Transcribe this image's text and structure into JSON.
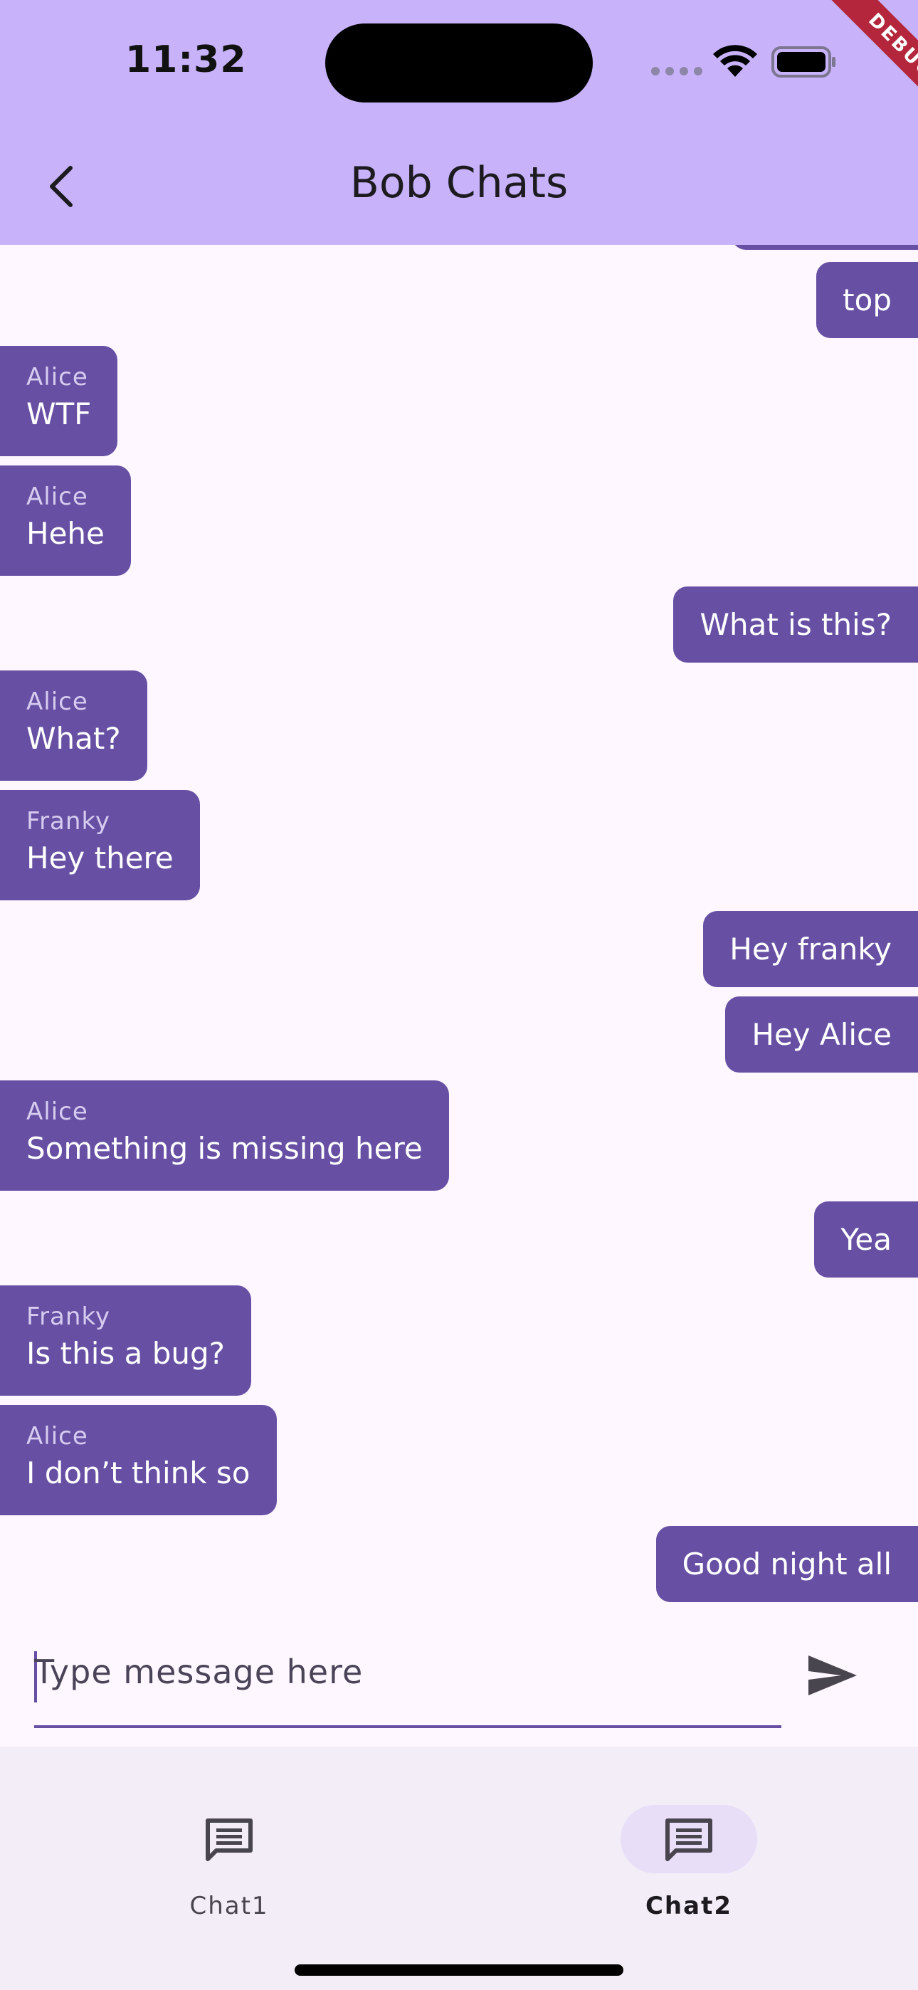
{
  "status_bar": {
    "time": "11:32"
  },
  "debug_banner": "DEBUG",
  "app_bar": {
    "title": "Bob Chats",
    "back_icon": "chevron-left-icon"
  },
  "messages": [
    {
      "direction": "out",
      "text": "top"
    },
    {
      "direction": "in",
      "sender": "Alice",
      "text": "WTF"
    },
    {
      "direction": "in",
      "sender": "Alice",
      "text": "Hehe"
    },
    {
      "direction": "out",
      "text": "What is this?"
    },
    {
      "direction": "in",
      "sender": "Alice",
      "text": "What?"
    },
    {
      "direction": "in",
      "sender": "Franky",
      "text": "Hey there"
    },
    {
      "direction": "out",
      "text": "Hey franky"
    },
    {
      "direction": "out",
      "text": "Hey Alice"
    },
    {
      "direction": "in",
      "sender": "Alice",
      "text": "Something is missing here"
    },
    {
      "direction": "out",
      "text": "Yea"
    },
    {
      "direction": "in",
      "sender": "Franky",
      "text": "Is this a bug?"
    },
    {
      "direction": "in",
      "sender": "Alice",
      "text": "I don’t think so"
    },
    {
      "direction": "out",
      "text": "Good night all"
    }
  ],
  "composer": {
    "placeholder": "Type message here",
    "send_icon": "send-icon"
  },
  "bottom_nav": [
    {
      "label": "Chat1",
      "icon": "chat-icon",
      "active": false
    },
    {
      "label": "Chat2",
      "icon": "chat-icon",
      "active": true
    }
  ],
  "colors": {
    "app_bar": "#c8b3fb",
    "bubble": "#6750a4",
    "background": "#fef7ff",
    "nav_background": "#f3edf7",
    "nav_active_pill": "#e8def8"
  }
}
